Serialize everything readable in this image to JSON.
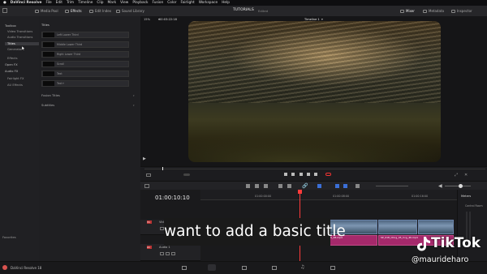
{
  "menubar": {
    "app": "DaVinci Resolve",
    "items": [
      "File",
      "Edit",
      "Trim",
      "Timeline",
      "Clip",
      "Mark",
      "View",
      "Playback",
      "Fusion",
      "Color",
      "Fairlight",
      "Workspace",
      "Help"
    ]
  },
  "toolbar": {
    "tabs": [
      "Media Pool",
      "Effects",
      "Edit Index",
      "Sound Library"
    ],
    "project": "TUTORIALS",
    "project_state": "Edited",
    "right_tabs": [
      "Mixer",
      "Metadata",
      "Inspector"
    ]
  },
  "effects_tree": {
    "toolbox": "Toolbox",
    "items": [
      "Video Transitions",
      "Audio Transitions",
      "Titles",
      "Generators",
      "Effects"
    ],
    "openfx": "Open FX",
    "audiofx": "Audio FX",
    "audio_items": [
      "Fairlight FX",
      "AU Effects"
    ],
    "favorites": "Favorites",
    "selected": "Titles"
  },
  "titles_panel": {
    "header": "Titles",
    "tiles": [
      {
        "thumb": "Left Lower Third",
        "label": "Left Lower Third"
      },
      {
        "thumb": "Middle Lower Third",
        "label": "Middle Lower Third"
      },
      {
        "thumb": "Right Lower Third",
        "label": "Right Lower Third"
      },
      {
        "thumb": "Scroll",
        "label": "Scroll"
      },
      {
        "thumb": "Basic Title",
        "label": "Text"
      },
      {
        "thumb": "Custom Title",
        "label": "Text+"
      }
    ],
    "fusion_titles": "Fusion Titles",
    "subtitles": "Subtitles"
  },
  "viewer": {
    "zoom": "15%",
    "timecode": "00:03:22:18",
    "timeline_name": "Timeline 1"
  },
  "timeline": {
    "timecode": "01:00:10:10",
    "ruler": [
      "01:00:00:00",
      "01:00:08:00",
      "01:00:16:00",
      "01:00:24:00"
    ],
    "video_track": "Video 1",
    "audio_track": "Audio 1",
    "clip_audio_1": "S_48.mp4",
    "clip_audio_2": "SP_018_Chng_45_Ccg_4K.mp4"
  },
  "meters": {
    "title": "Meters",
    "room": "Control Room"
  },
  "pagebar": {
    "app_version": "DaVinci Resolve 18"
  },
  "overlay": {
    "caption": "want to add a basic title",
    "brand": "TikTok",
    "handle": "@maurideharo"
  }
}
